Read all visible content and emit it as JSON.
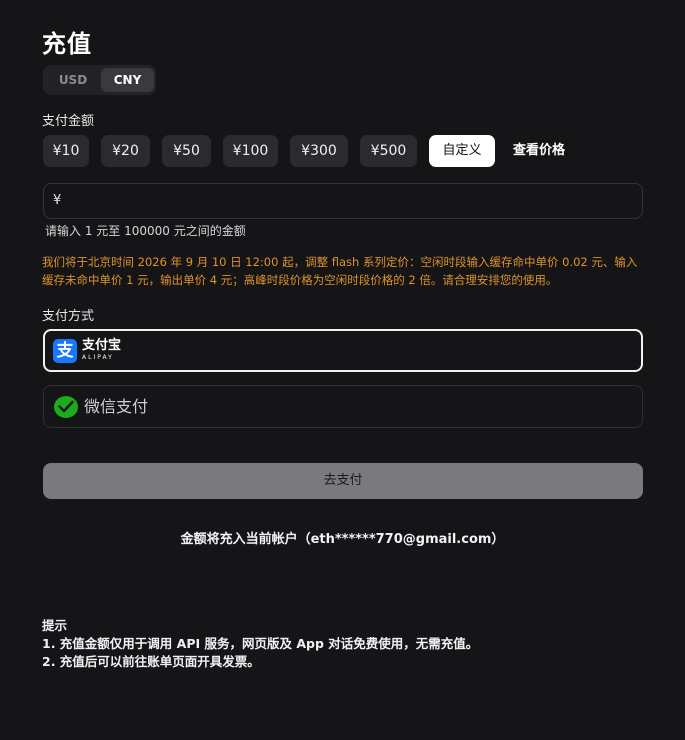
{
  "page": {
    "title": "充值"
  },
  "currency": {
    "options": [
      "USD",
      "CNY"
    ],
    "selected": "CNY"
  },
  "amount": {
    "label": "支付金额",
    "presets": [
      "¥10",
      "¥20",
      "¥50",
      "¥100",
      "¥300",
      "¥500"
    ],
    "custom_label": "自定义",
    "price_link": "查看价格",
    "currency_symbol": "¥",
    "input_value": "",
    "range_hint": "请输入 1 元至 100000 元之间的金额"
  },
  "notice": {
    "text": "我们将于北京时间 2026 年 9 月 10 日 12:00 起，调整 flash 系列定价：空闲时段输入缓存命中单价 0.02 元、输入缓存未命中单价 1 元，输出单价 4 元；高峰时段价格为空闲时段价格的 2 倍。请合理安排您的使用。",
    "color": "#e0922b"
  },
  "payment": {
    "label": "支付方式",
    "alipay": {
      "icon": "alipay-icon",
      "glyph": "支",
      "name": "支付宝",
      "sub": "ALIPAY",
      "selected": true
    },
    "wechat": {
      "icon": "wechat-pay-icon",
      "name": "微信支付",
      "selected": false
    },
    "submit_label": "去支付"
  },
  "account_note": "金额将充入当前帐户（eth******770@gmail.com）",
  "tips": {
    "title": "提示",
    "items": [
      "1. 充值金额仅用于调用 API 服务，网页版及 App 对话免费使用，无需充值。",
      "2. 充值后可以前往账单页面开具发票。"
    ]
  },
  "colors": {
    "background": "#151517",
    "alipay_blue": "#1677ff",
    "wechat_green": "#1aad19",
    "button_disabled": "#7a7a7c"
  }
}
